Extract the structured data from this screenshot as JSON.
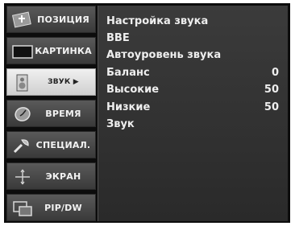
{
  "sidebar": {
    "items": [
      {
        "label": "ПОЗИЦИЯ",
        "icon": "position-icon"
      },
      {
        "label": "КАРТИНКА",
        "icon": "picture-icon"
      },
      {
        "label": "ЗВУК ▶",
        "icon": "sound-icon"
      },
      {
        "label": "ВРЕМЯ",
        "icon": "time-icon"
      },
      {
        "label": "СПЕЦИАЛ.",
        "icon": "special-icon"
      },
      {
        "label": "ЭКРАН",
        "icon": "screen-icon"
      },
      {
        "label": "PIP/DW",
        "icon": "pip-icon"
      }
    ],
    "active_index": 2
  },
  "sound_menu": {
    "items": [
      {
        "label": "Настройка звука",
        "value": ""
      },
      {
        "label": "BBE",
        "value": ""
      },
      {
        "label": "Автоуровень звука",
        "value": ""
      },
      {
        "label": "Баланс",
        "value": "0"
      },
      {
        "label": "Высокие",
        "value": "50"
      },
      {
        "label": "Низкие",
        "value": "50"
      },
      {
        "label": "Звук",
        "value": ""
      }
    ]
  },
  "colors": {
    "frame": "#0c0c0c",
    "panel": "#333333",
    "sidebar_item": "#4a4a4a",
    "sidebar_active": "#e0e0e0",
    "text": "#eeeeee"
  }
}
